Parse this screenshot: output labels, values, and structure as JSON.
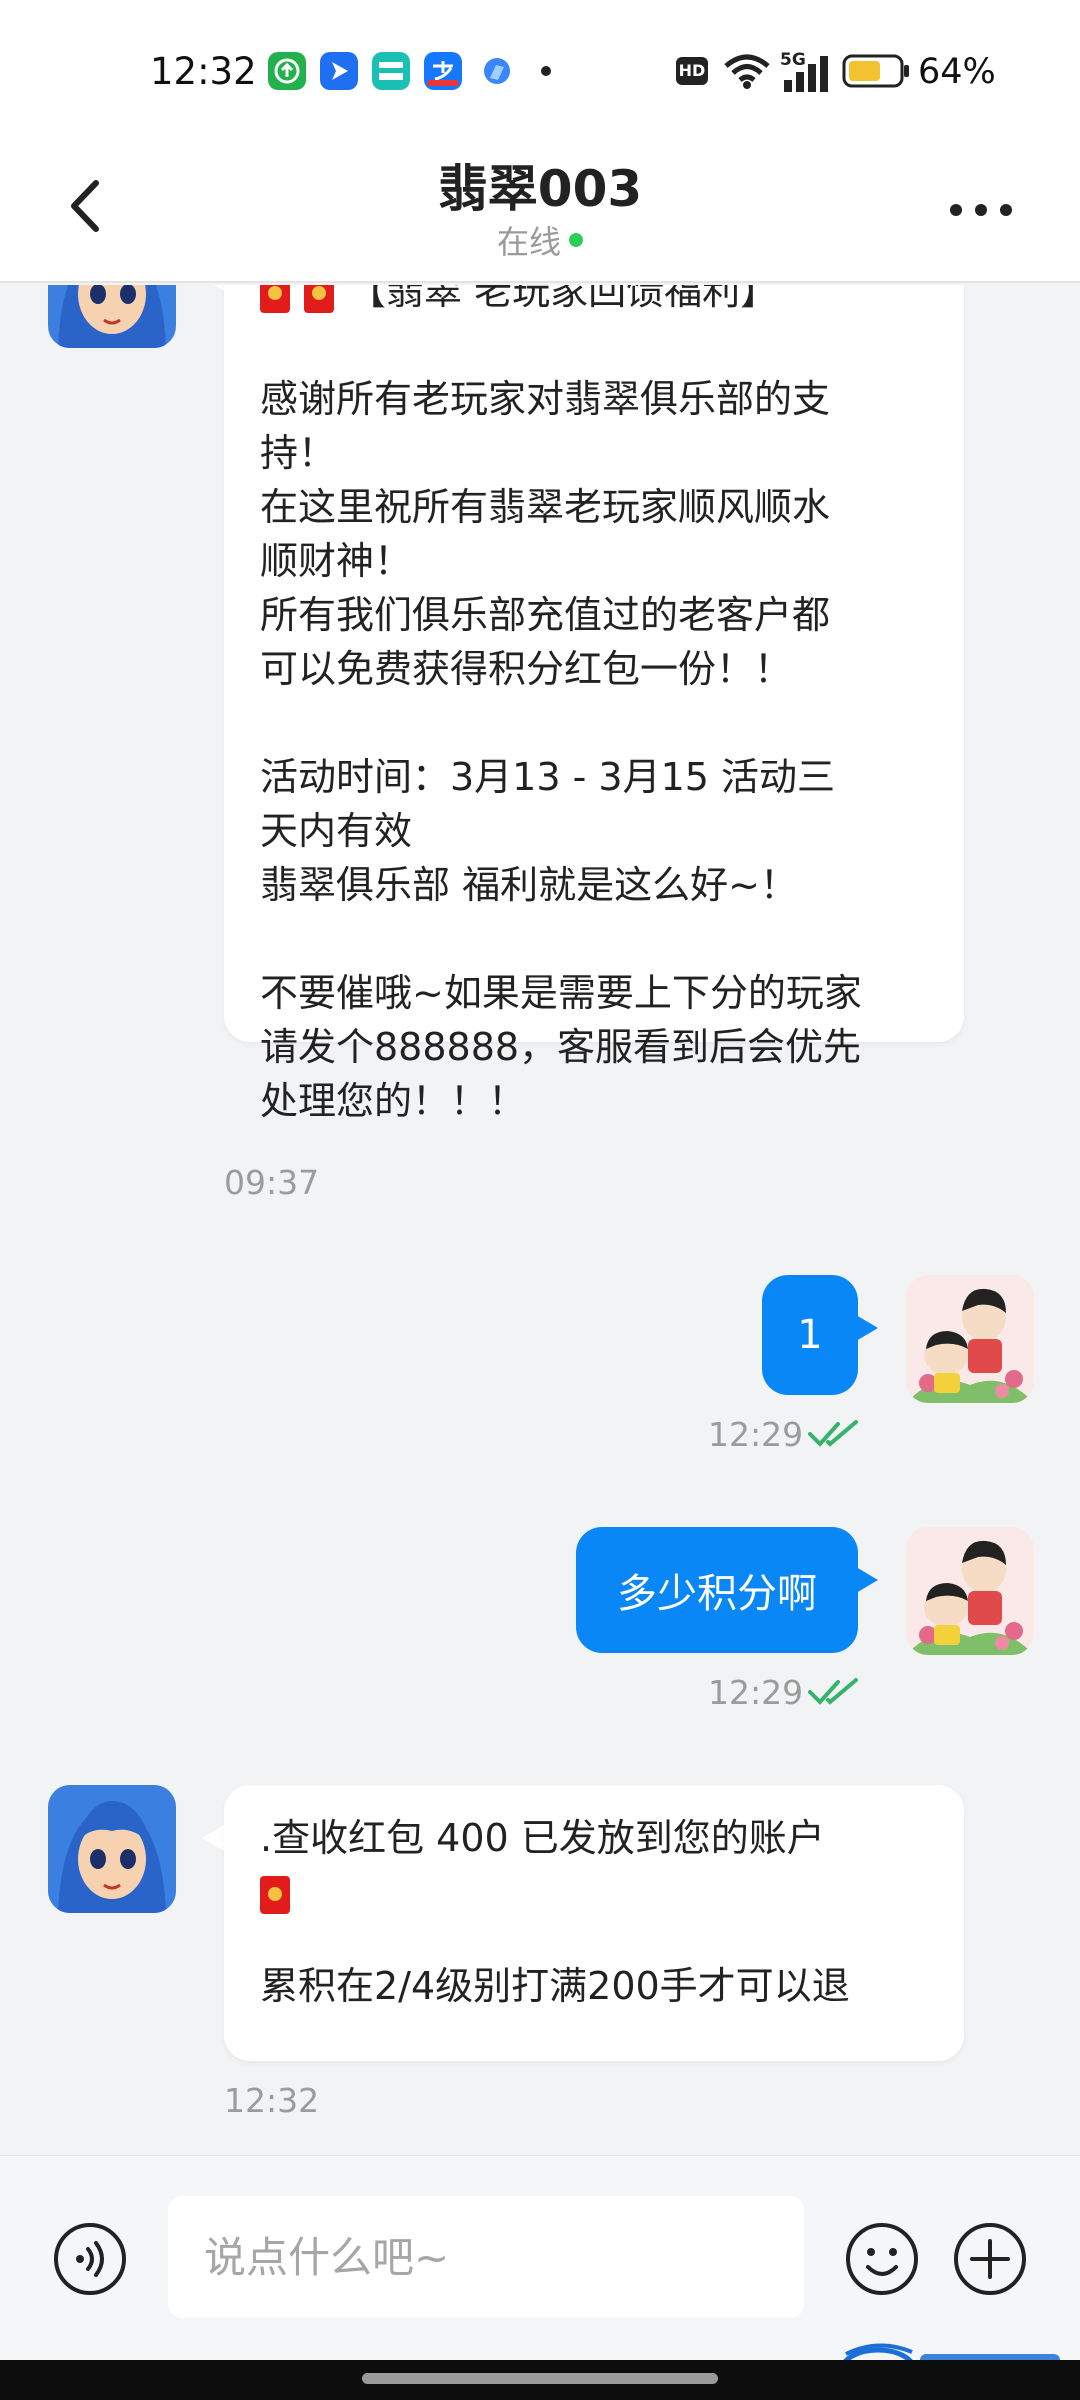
{
  "status_bar": {
    "time": "12:32",
    "network": "5G",
    "battery_percent": "64%",
    "battery_level": 0.64
  },
  "header": {
    "title": "翡翠003",
    "status": "在线",
    "back_icon": "chevron-left-icon",
    "more_icon": "more-dots-icon"
  },
  "messages": [
    {
      "direction": "in",
      "lines": [
        "【翡翠 老玩家回馈福利】",
        "",
        "感谢所有老玩家对翡翠俱乐部的支",
        "持！",
        "在这里祝所有翡翠老玩家顺风顺水",
        "顺财神！",
        "所有我们俱乐部充值过的老客户都",
        "可以免费获得积分红包一份！！",
        "",
        "活动时间：3月13 - 3月15   活动三",
        "天内有效",
        "翡翠俱乐部 福利就是这么好~！",
        "",
        "不要催哦~如果是需要上下分的玩家",
        "请发个888888，客服看到后会优先",
        "处理您的！！！"
      ],
      "time": "09:37"
    },
    {
      "direction": "out",
      "text": "1",
      "time": "12:29",
      "read": true
    },
    {
      "direction": "out",
      "text": "多少积分啊",
      "time": "12:29",
      "read": true
    },
    {
      "direction": "in",
      "lines": [
        ".查收红包 400  已发放到您的账户",
        "",
        "",
        "累积在2/4级别打满200手才可以退"
      ],
      "time": "12:32"
    }
  ],
  "input": {
    "placeholder": "说点什么吧~",
    "voice_icon": "voice-icon",
    "emoji_icon": "emoji-icon",
    "plus_icon": "plus-icon"
  },
  "colors": {
    "outgoing_bubble": "#0a87f7",
    "online": "#2ecc5a",
    "read_check": "#35b36b"
  }
}
